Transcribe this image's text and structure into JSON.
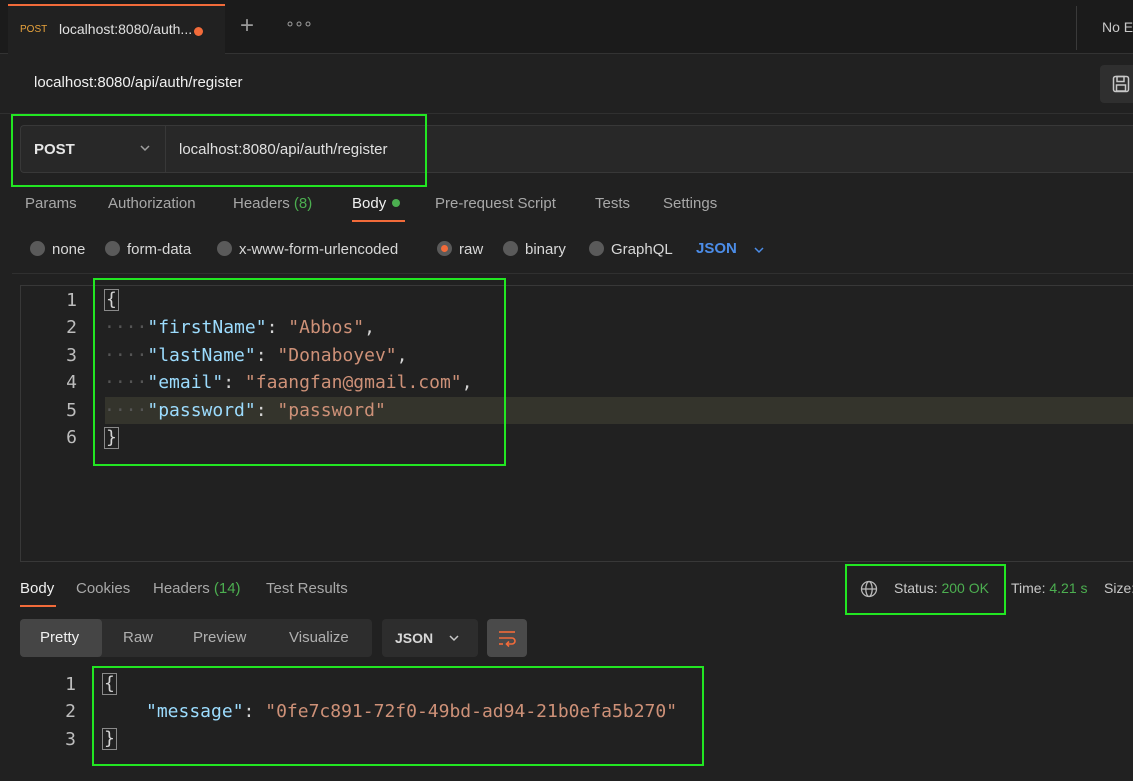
{
  "tab": {
    "method": "POST",
    "title": "localhost:8080/auth..."
  },
  "tabbar": {
    "new_tab": "+",
    "more": "∘∘∘",
    "environment": "No E"
  },
  "request": {
    "title": "localhost:8080/api/auth/register",
    "method": "POST",
    "url": "localhost:8080/api/auth/register"
  },
  "request_tabs": {
    "params": "Params",
    "authorization": "Authorization",
    "headers": "Headers",
    "headers_count": "(8)",
    "body": "Body",
    "pre_request": "Pre-request Script",
    "tests": "Tests",
    "settings": "Settings"
  },
  "body_types": {
    "none": "none",
    "form_data": "form-data",
    "urlencoded": "x-www-form-urlencoded",
    "raw": "raw",
    "binary": "binary",
    "graphql": "GraphQL",
    "language": "JSON",
    "selected": "raw"
  },
  "request_body": {
    "line_numbers": [
      "1",
      "2",
      "3",
      "4",
      "5",
      "6"
    ],
    "open": "{",
    "close": "}",
    "fields": [
      {
        "key": "\"firstName\"",
        "value": "\"Abbos\"",
        "trail": ","
      },
      {
        "key": "\"lastName\"",
        "value": "\"Donaboyev\"",
        "trail": ","
      },
      {
        "key": "\"email\"",
        "value": "\"faangfan@gmail.com\"",
        "trail": ","
      },
      {
        "key": "\"password\"",
        "value": "\"password\"",
        "trail": ""
      }
    ],
    "indent": "····"
  },
  "response_tabs": {
    "body": "Body",
    "cookies": "Cookies",
    "headers": "Headers",
    "headers_count": "(14)",
    "test_results": "Test Results"
  },
  "response_meta": {
    "status_label": "Status:",
    "status_value": "200 OK",
    "time_label": "Time:",
    "time_value": "4.21 s",
    "size_label": "Size:"
  },
  "view_modes": {
    "pretty": "Pretty",
    "raw": "Raw",
    "preview": "Preview",
    "visualize": "Visualize",
    "format": "JSON"
  },
  "response_body": {
    "line_numbers": [
      "1",
      "2",
      "3"
    ],
    "open": "{",
    "close": "}",
    "key": "\"message\"",
    "value": "\"0fe7c891-72f0-49bd-ad94-21b0efa5b270\""
  },
  "colors": {
    "accent": "#f26b3a",
    "success": "#4caf50",
    "link": "#4c8de8",
    "annotation": "#22e622"
  }
}
